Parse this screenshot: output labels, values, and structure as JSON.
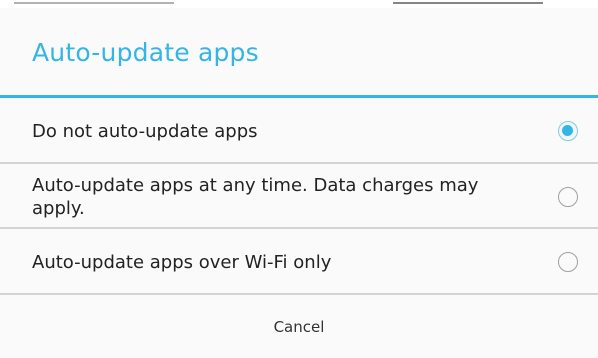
{
  "dialog": {
    "title": "Auto-update apps",
    "accent_color": "#33b5e5",
    "options": [
      {
        "label": "Do not auto-update apps",
        "selected": true
      },
      {
        "label": "Auto-update apps at any time. Data charges may apply.",
        "selected": false
      },
      {
        "label": "Auto-update apps over Wi-Fi only",
        "selected": false
      }
    ],
    "cancel_label": "Cancel"
  }
}
